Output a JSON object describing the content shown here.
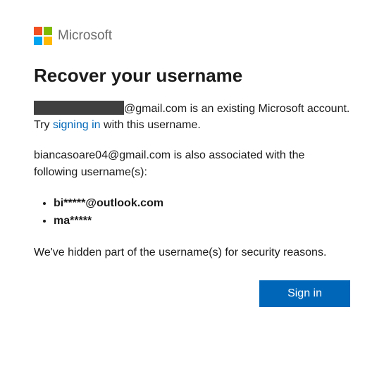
{
  "brand": "Microsoft",
  "title": "Recover your username",
  "email_domain": "@gmail.com",
  "existing_text_1": " is an existing Microsoft account. Try ",
  "signin_link": "signing in",
  "existing_text_2": " with this username.",
  "associated_email": "biancasoare04@gmail.com",
  "associated_text": " is also associated with the following username(s):",
  "usernames": {
    "0": "bi*****@outlook.com",
    "1": "ma*****"
  },
  "hidden_notice": "We've hidden part of the username(s) for security reasons.",
  "signin_button": "Sign in"
}
